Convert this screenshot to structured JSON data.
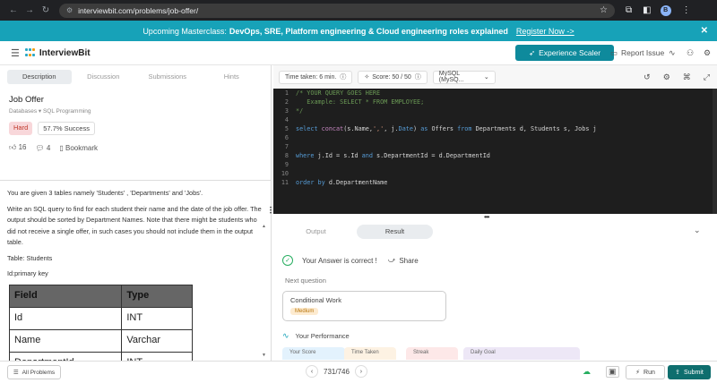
{
  "browser": {
    "url": "interviewbit.com/problems/job-offer/",
    "profile_initial": "B"
  },
  "banner": {
    "prefix": "Upcoming Masterclass:",
    "highlight": "DevOps, SRE, Platform engineering & Cloud engineering roles explained",
    "register": "Register Now ->"
  },
  "header": {
    "logo": "InterviewBit",
    "experience_button": "Experience Scaler",
    "report": "Report Issue"
  },
  "left": {
    "tabs": [
      "Description",
      "Discussion",
      "Submissions",
      "Hints"
    ],
    "title": "Job Offer",
    "breadcrumb": "Databases ▾ SQL Programming",
    "difficulty": "Hard",
    "success": "57.7% Success",
    "likes": "16",
    "comments": "4",
    "bookmark": "Bookmark",
    "desc": [
      "You are given 3 tables namely 'Students' , 'Departments' and 'Jobs'.",
      "Write an SQL query to find for each student their name and the date of the job offer. The output should be sorted by Department Names. Note that there might be students who did not receive a single offer, in such cases you should not include them in the output table.",
      "Table: Students",
      "Id:primary key"
    ],
    "table": {
      "headers": [
        "Field",
        "Type"
      ],
      "rows": [
        [
          "Id",
          "INT"
        ],
        [
          "Name",
          "Varchar"
        ],
        [
          "DepartmentId",
          "INT"
        ]
      ]
    }
  },
  "editor": {
    "time": "Time taken: 6 min.",
    "score": "Score: 50 / 50",
    "language": "MySQL (MySQ...",
    "lines": [
      "1",
      "2",
      "3",
      "4",
      "5",
      "6",
      "7",
      "8",
      "9",
      "10",
      "11"
    ]
  },
  "result": {
    "tabs": [
      "Output",
      "Result"
    ],
    "answer": "Your Answer is correct !",
    "share": "Share",
    "next_label": "Next question",
    "next_title": "Conditional Work",
    "next_level": "Medium",
    "performance": "Your Performance",
    "perf_cards": [
      "Your Score",
      "Time Taken",
      "Streak",
      "Daily Goal"
    ]
  },
  "footer": {
    "all_problems": "All Problems",
    "page": "731/746",
    "run": "Run",
    "submit": "Submit"
  },
  "colors": {
    "banner": "#17a2b8",
    "submit": "#0e6e6e",
    "hard": "#c0392b"
  }
}
